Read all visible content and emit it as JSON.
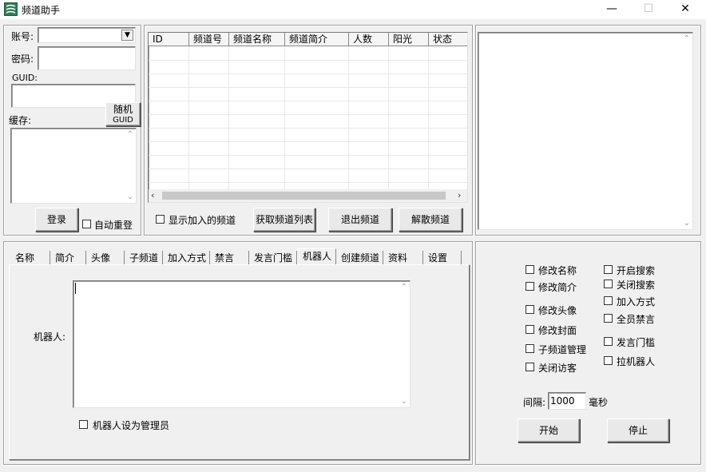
{
  "window": {
    "title": "频道助手",
    "minimize": "—",
    "maximize": "☐",
    "close": "✕"
  },
  "login": {
    "account_label": "账号:",
    "password_label": "密码:",
    "guid_label": "GUID:",
    "random_guid_line1": "随机",
    "random_guid_line2": "GUID",
    "cache_label": "缓存:",
    "login_button": "登录",
    "auto_relogin": "自动重登"
  },
  "channels": {
    "columns": [
      "ID",
      "频道号",
      "频道名称",
      "频道简介",
      "人数",
      "阳光",
      "状态"
    ],
    "show_joined": "显示加入的频道",
    "get_list_button": "获取频道列表",
    "exit_button": "退出频道",
    "dissolve_button": "解散频道"
  },
  "tabs": [
    "名称",
    "简介",
    "头像",
    "子频道",
    "加入方式",
    "禁言",
    "发言门槛",
    "机器人",
    "创建频道",
    "资料",
    "设置"
  ],
  "active_tab": "机器人",
  "robot": {
    "label": "机器人:",
    "set_admin": "机器人设为管理员"
  },
  "options": {
    "left": [
      "修改名称",
      "修改简介",
      "修改头像",
      "修改封面",
      "子频道管理",
      "关闭访客"
    ],
    "right": [
      "开启搜索",
      "关闭搜索",
      "加入方式",
      "全员禁言",
      "发言门槛",
      "拉机器人"
    ],
    "interval_label": "间隔:",
    "interval_value": "1000",
    "interval_unit": "毫秒",
    "start_button": "开始",
    "stop_button": "停止"
  },
  "icons": {
    "app": "app-logo-icon",
    "dropdown": "chevron-down-icon",
    "scroll_up": "scroll-up-arrow-icon",
    "scroll_down": "scroll-down-arrow-icon",
    "scroll_left": "scroll-left-arrow-icon",
    "scroll_right": "scroll-right-arrow-icon"
  },
  "colors": {
    "background": "#f0f0f0",
    "field": "#ffffff",
    "app_icon": "#2f7d5a"
  }
}
